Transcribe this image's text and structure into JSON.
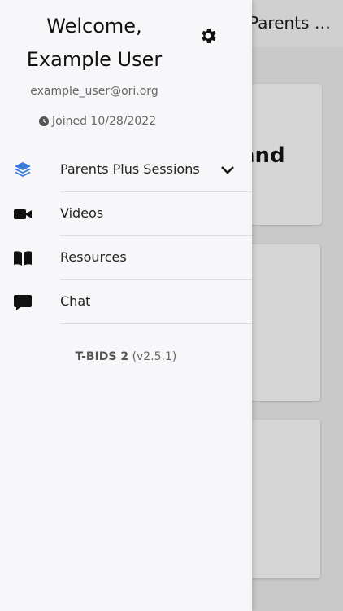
{
  "background": {
    "header_title": "Parents Plus Sessions",
    "card_text": "and"
  },
  "drawer": {
    "welcome_line1": "Welcome,",
    "welcome_line2": "Example User",
    "email": "example_user@ori.org",
    "joined": "Joined 10/28/2022",
    "settings_icon": "gear-icon",
    "nav": [
      {
        "label": "Parents Plus Sessions",
        "icon": "layers-icon",
        "color": "#3a7bdc"
      },
      {
        "label": "Videos",
        "icon": "video-camera-icon"
      },
      {
        "label": "Resources",
        "icon": "book-icon"
      },
      {
        "label": "Chat",
        "icon": "chat-bubble-icon"
      }
    ],
    "app_name": "T-BIDS 2",
    "app_version": "(v2.5.1)"
  }
}
